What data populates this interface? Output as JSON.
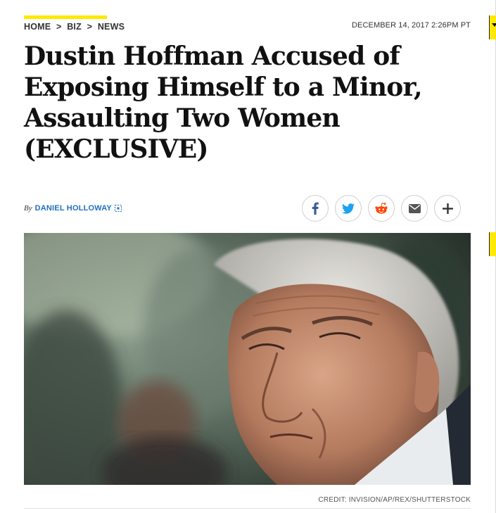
{
  "breadcrumb": {
    "items": [
      "HOME",
      "BIZ",
      "NEWS"
    ],
    "separator": ">"
  },
  "dateline": "DECEMBER 14, 2017 2:26PM PT",
  "headline": "Dustin Hoffman Accused of Exposing Himself to a Minor, Assaulting Two Women (EXCLUSIVE)",
  "byline": {
    "by": "By",
    "author": "DANIEL HOLLOWAY"
  },
  "share": [
    {
      "icon": "facebook-icon",
      "color": "#3b5998"
    },
    {
      "icon": "twitter-icon",
      "color": "#1da1f2"
    },
    {
      "icon": "reddit-icon",
      "color": "#ff4500"
    },
    {
      "icon": "email-icon",
      "color": "#555555"
    },
    {
      "icon": "plus-icon",
      "color": "#333333"
    }
  ],
  "photo": {
    "credit": "CREDIT: INVISION/AP/REX/SHUTTERSTOCK"
  },
  "colors": {
    "accent": "#ffe900",
    "link": "#1f6fbf"
  }
}
